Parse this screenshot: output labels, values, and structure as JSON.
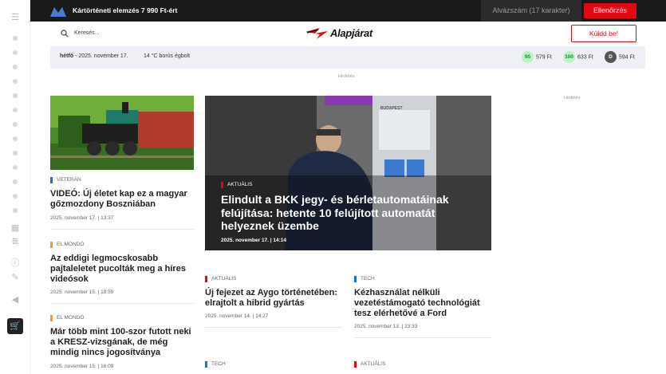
{
  "topbar": {
    "promo": "Kártörténeti elemzés 7 990 Ft-ért",
    "vin_placeholder": "Alvázszám (17 karakter)",
    "check_label": "Ellenőrzés"
  },
  "header": {
    "search_label": "Keresés...",
    "brand": "Alapjárat",
    "send_label": "Küldd be!"
  },
  "infobar": {
    "day": "hétfő",
    "date": "- 2025. november 17.",
    "weather": "14 °C  borús égbolt",
    "fuels": [
      {
        "badge": "95",
        "price": "579 Ft",
        "color": "#bff0c8",
        "text_color": "#1a8c3a"
      },
      {
        "badge": "100",
        "price": "633 Ft",
        "color": "#bff0c8",
        "text_color": "#1a8c3a"
      },
      {
        "badge": "D",
        "price": "594 Ft",
        "color": "#555555",
        "text_color": "#ffffff"
      }
    ]
  },
  "ads": {
    "top": "Hirdetés",
    "right": "Hirdetés"
  },
  "articles": {
    "a1": {
      "category": "VETERÁN",
      "title": "VIDEÓ: Új életet kap ez a magyar gőzmozdony Boszniában",
      "meta": "2025. november 17. | 13:37",
      "color": "#1e6fd9"
    },
    "a2": {
      "category": "EL MONDÓ",
      "title": "Az eddigi legmocskosabb pajtaleletet pucolták meg a híres videósok",
      "meta": "2025. november 15. | 18:59",
      "color": "#f39c12"
    },
    "a3": {
      "category": "EL MONDÓ",
      "title": "Már több mint 100-szor futott neki a KRESZ-vizsgának, de még mindig nincs jogosítványa",
      "meta": "2025. november 15. | 16:09",
      "color": "#f39c12"
    },
    "hero": {
      "category": "AKTUÁLIS",
      "title": "Elindult a BKK jegy- és bérletautomatáinak felújítása: hetente 10 felújított automatát helyeznek üzembe",
      "meta": "2025. november 17. | 14:14",
      "color": "#e30613",
      "sign": "BUDAPEST"
    },
    "a4": {
      "category": "AKTUÁLIS",
      "title": "Új fejezet az Aygo történetében: elrajtolt a hibrid gyártás",
      "meta": "2025. november 14. | 14:27",
      "color": "#e30613"
    },
    "a5": {
      "category": "TECH",
      "title": "Kézhasználat nélküli vezetéstámogató technológiát tesz elérhetővé a Ford",
      "meta": "2025. november 13. | 23:33",
      "color": "#1e6fd9"
    },
    "a6": {
      "category": "TECH",
      "color": "#1e6fd9"
    },
    "a7": {
      "category": "AKTUÁLIS",
      "color": "#e30613"
    }
  }
}
